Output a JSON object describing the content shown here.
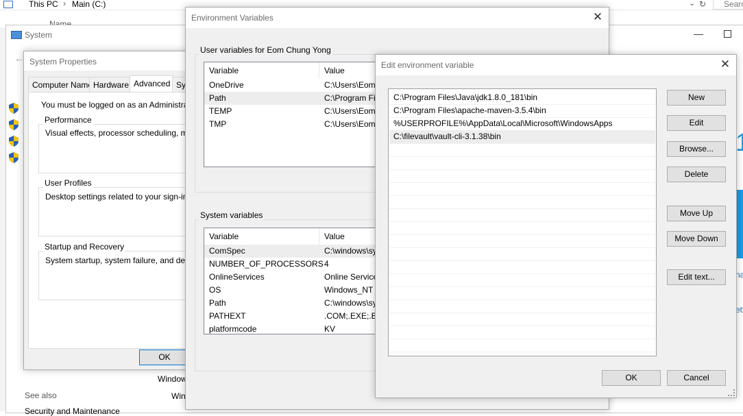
{
  "explorer": {
    "crumb_this_pc": "This PC",
    "crumb_main": "Main (C:)",
    "search_placeholder": "Searc",
    "name_header": "Name"
  },
  "system_window": {
    "title": "System",
    "bottom_left_texts": [
      "See also",
      "Security and Maintenance"
    ],
    "bottom_mid_texts": [
      "Window",
      "Win"
    ],
    "right_texts": [
      "1",
      "na",
      "ett"
    ]
  },
  "system_properties": {
    "title": "System Properties",
    "tabs": [
      "Computer Name",
      "Hardware",
      "Advanced",
      "Sys"
    ],
    "admin_note": "You must be logged on as an Administrator to",
    "groups": [
      {
        "label": "Performance",
        "text": "Visual effects, processor scheduling, memor"
      },
      {
        "label": "User Profiles",
        "text": "Desktop settings related to your sign-in"
      },
      {
        "label": "Startup and Recovery",
        "text": "System startup, system failure, and debuggi"
      }
    ],
    "ok_label": "OK"
  },
  "env_vars": {
    "title": "Environment Variables",
    "user_label": "User variables for Eom Chung Yong",
    "system_label": "System variables",
    "col_variable": "Variable",
    "col_value": "Value",
    "user_rows": [
      {
        "variable": "OneDrive",
        "value": "C:\\Users\\Eom"
      },
      {
        "variable": "Path",
        "value": "C:\\Program Fil"
      },
      {
        "variable": "TEMP",
        "value": "C:\\Users\\Eom"
      },
      {
        "variable": "TMP",
        "value": "C:\\Users\\Eom"
      }
    ],
    "system_rows": [
      {
        "variable": "ComSpec",
        "value": "C:\\windows\\sy"
      },
      {
        "variable": "NUMBER_OF_PROCESSORS",
        "value": "4"
      },
      {
        "variable": "OnlineServices",
        "value": "Online Service"
      },
      {
        "variable": "OS",
        "value": "Windows_NT"
      },
      {
        "variable": "Path",
        "value": "C:\\windows\\sy"
      },
      {
        "variable": "PATHEXT",
        "value": ".COM;.EXE;.BA"
      },
      {
        "variable": "platformcode",
        "value": "KV"
      }
    ]
  },
  "edit_env": {
    "title": "Edit environment variable",
    "entries": [
      "C:\\Program Files\\Java\\jdk1.8.0_181\\bin",
      "C:\\Program Files\\apache-maven-3.5.4\\bin",
      "%USERPROFILE%\\AppData\\Local\\Microsoft\\WindowsApps",
      "C:\\filevault\\vault-cli-3.1.38\\bin"
    ],
    "buttons": {
      "new": "New",
      "edit": "Edit",
      "browse": "Browse...",
      "delete": "Delete",
      "move_up": "Move Up",
      "move_down": "Move Down",
      "edit_text": "Edit text...",
      "ok": "OK",
      "cancel": "Cancel"
    }
  },
  "colors": {
    "accent": "#0078d7",
    "selection": "#ededed",
    "shield_blue": "#2a5fb5",
    "shield_yellow": "#f1c40f"
  }
}
